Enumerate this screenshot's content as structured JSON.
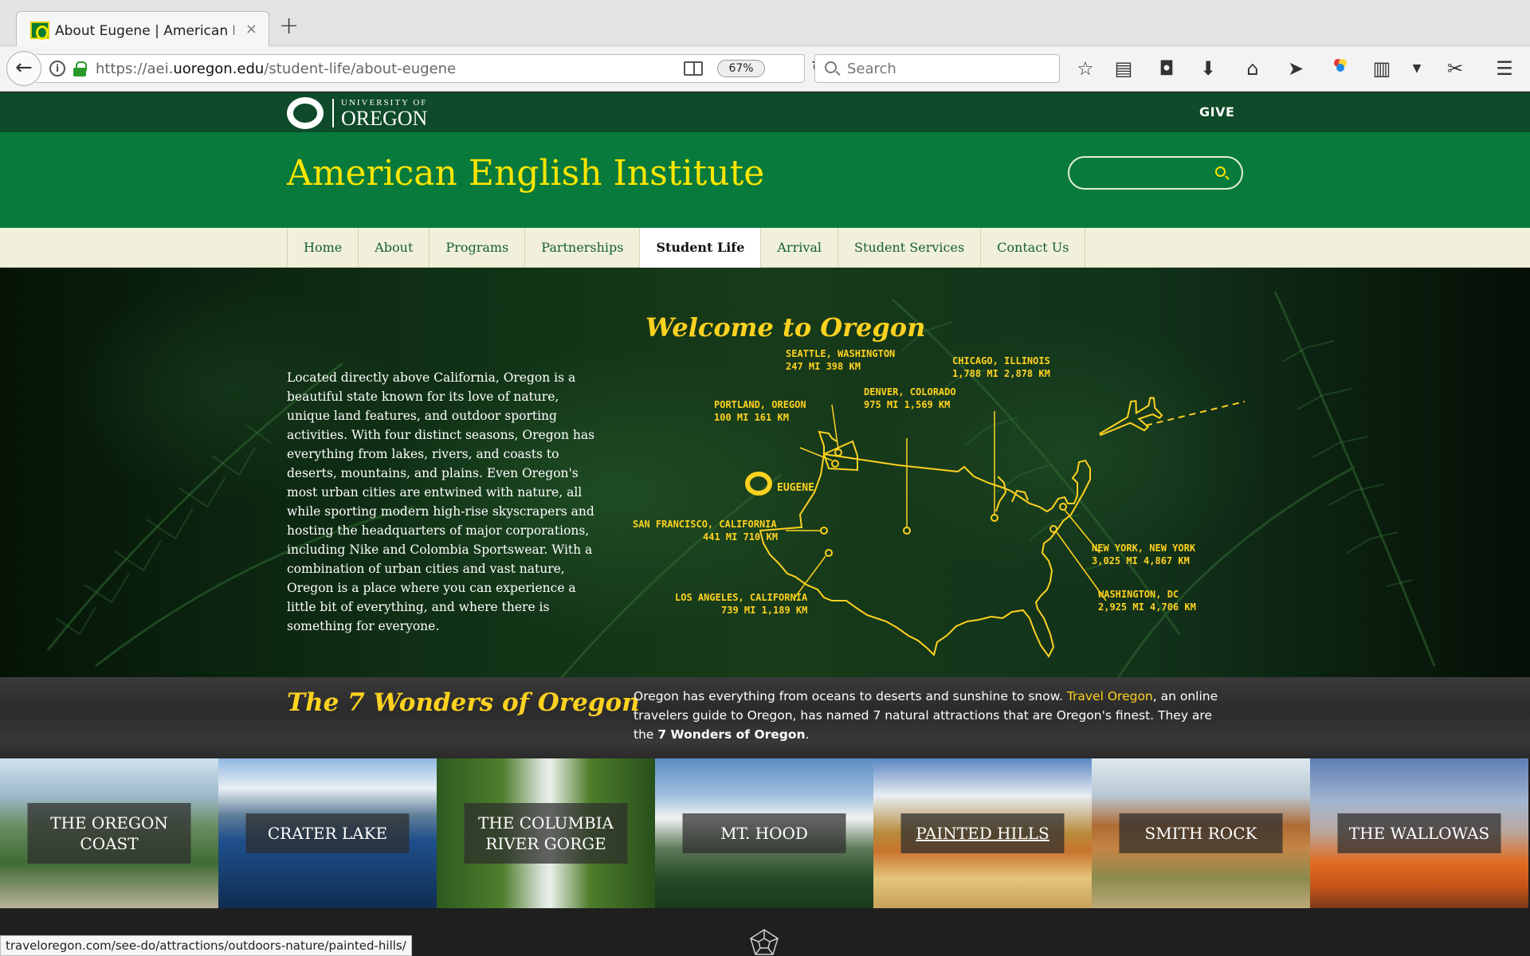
{
  "browser": {
    "tab_title": "About Eugene | American Eng",
    "tab_close": "×",
    "new_tab": "+",
    "url_prefix": "https://aei.",
    "url_domain": "uoregon.edu",
    "url_path": "/student-life/about-eugene",
    "zoom": "67%",
    "search_placeholder": "Search",
    "status_url": "traveloregon.com/see-do/attractions/outdoors-nature/painted-hills/"
  },
  "university": {
    "logo_small": "UNIVERSITY OF",
    "logo_big": "OREGON",
    "give_label": "GIVE"
  },
  "site": {
    "title": "American English Institute"
  },
  "nav": [
    {
      "label": "Home"
    },
    {
      "label": "About"
    },
    {
      "label": "Programs"
    },
    {
      "label": "Partnerships"
    },
    {
      "label": "Student Life",
      "active": true
    },
    {
      "label": "Arrival"
    },
    {
      "label": "Student Services"
    },
    {
      "label": "Contact Us"
    }
  ],
  "hero": {
    "title": "Welcome to Oregon",
    "body": "Located directly above California, Oregon is a beautiful state known for its love of nature, unique land features, and outdoor sporting activities. With four distinct seasons, Oregon has everything from lakes, rivers, and coasts to deserts, mountains, and plains. Even Oregon's most urban cities are entwined with nature, all while sporting modern high-rise skyscrapers and hosting the headquarters of major corporations, including Nike and Colombia Sportswear. With a combination of urban cities and vast nature, Oregon is a place where you can experience a little bit of everything, and where there is something for everyone.",
    "map": {
      "eugene": "EUGENE",
      "cities": [
        {
          "name": "SEATTLE, WASHINGTON",
          "dist": "247 MI  398 KM"
        },
        {
          "name": "CHICAGO, ILLINOIS",
          "dist": "1,788 MI  2,878 KM"
        },
        {
          "name": "DENVER, COLORADO",
          "dist": "975 MI  1,569 KM"
        },
        {
          "name": "PORTLAND, OREGON",
          "dist": "100 MI  161 KM"
        },
        {
          "name": "SAN FRANCISCO, CALIFORNIA",
          "dist": "441 MI 710 KM"
        },
        {
          "name": "LOS ANGELES, CALIFORNIA",
          "dist": "739 MI 1,189 KM"
        },
        {
          "name": "NEW YORK, NEW YORK",
          "dist": "3,025 MI  4,867 KM"
        },
        {
          "name": "WASHINGTON, DC",
          "dist": "2,925 MI 4,706 KM"
        }
      ]
    }
  },
  "wonders": {
    "title": "The 7 Wonders of Oregon",
    "desc_part1": "Oregon has everything from oceans to deserts and sunshine to snow. ",
    "desc_link": "Travel Oregon",
    "desc_part2": ", an online travelers guide to Oregon, has named 7 natural attractions that are Oregon's finest. They are the ",
    "desc_bold": "7 Wonders of Oregon",
    "desc_end": ".",
    "tiles": [
      {
        "label": "THE OREGON COAST"
      },
      {
        "label": "CRATER LAKE"
      },
      {
        "label": "THE COLUMBIA RIVER GORGE"
      },
      {
        "label": "MT. HOOD"
      },
      {
        "label": "PAINTED HILLS"
      },
      {
        "label": "SMITH ROCK"
      },
      {
        "label": "THE WALLOWAS"
      }
    ]
  },
  "colors": {
    "uo_green": "#087a3c",
    "uo_dark_green": "#0f4a2a",
    "uo_yellow": "#ffd21f"
  }
}
